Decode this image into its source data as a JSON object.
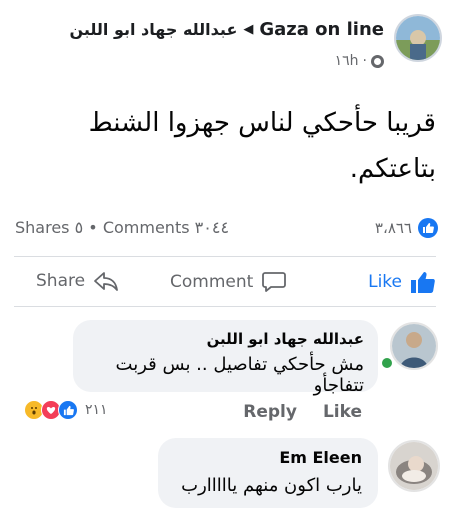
{
  "post": {
    "page_name": "Gaza on line",
    "author_name": "عبدالله جهاد ابو اللبن",
    "time": "١٦h",
    "dot": "·",
    "text_line1": "قريبا حأحكي لناس جهزوا الشنط",
    "text_line2": "بتاعتكم."
  },
  "stats": {
    "shares_label": "Shares",
    "shares_count": "٥",
    "separator": "•",
    "comments_label": "Comments",
    "comments_count": "٣٠٤٤",
    "reactions_count": "٣،٨٦٦"
  },
  "actions": {
    "share": "Share",
    "comment": "Comment",
    "like": "Like"
  },
  "comments": [
    {
      "name": "عبدالله جهاد ابو اللبن",
      "text": "مش حأحكي تفاصيل .. بس قربت تتفاجأو",
      "reply_label": "Reply",
      "like_label": "Like",
      "reactions_count": "٢١١"
    },
    {
      "name": "Em Eleen",
      "text": "يارب اكون منهم يااااارب"
    }
  ],
  "colors": {
    "accent": "#1877f2",
    "secondary_text": "#65676b",
    "bubble": "#f0f2f5",
    "online": "#31a24c"
  }
}
